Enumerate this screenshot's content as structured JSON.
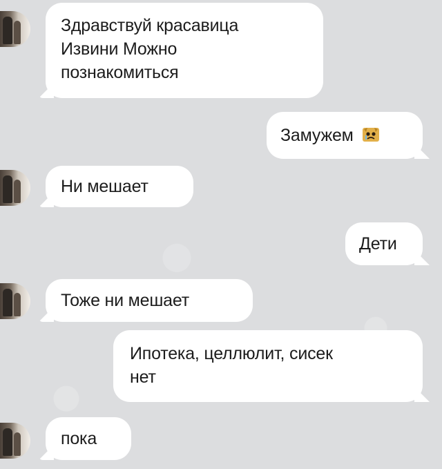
{
  "messages": [
    {
      "side": "incoming",
      "lines": [
        "Здравствуй красавица",
        "Извини Можно",
        "познакомиться"
      ]
    },
    {
      "side": "outgoing",
      "text": "Замужем",
      "emoji": "crying-cat-emoji"
    },
    {
      "side": "incoming",
      "text": "Ни мешает"
    },
    {
      "side": "outgoing",
      "text": "Дети"
    },
    {
      "side": "incoming",
      "text": "Тоже ни мешает"
    },
    {
      "side": "outgoing",
      "lines": [
        "Ипотека, целлюлит, сисек",
        "нет"
      ]
    },
    {
      "side": "incoming",
      "text": "пока"
    }
  ]
}
